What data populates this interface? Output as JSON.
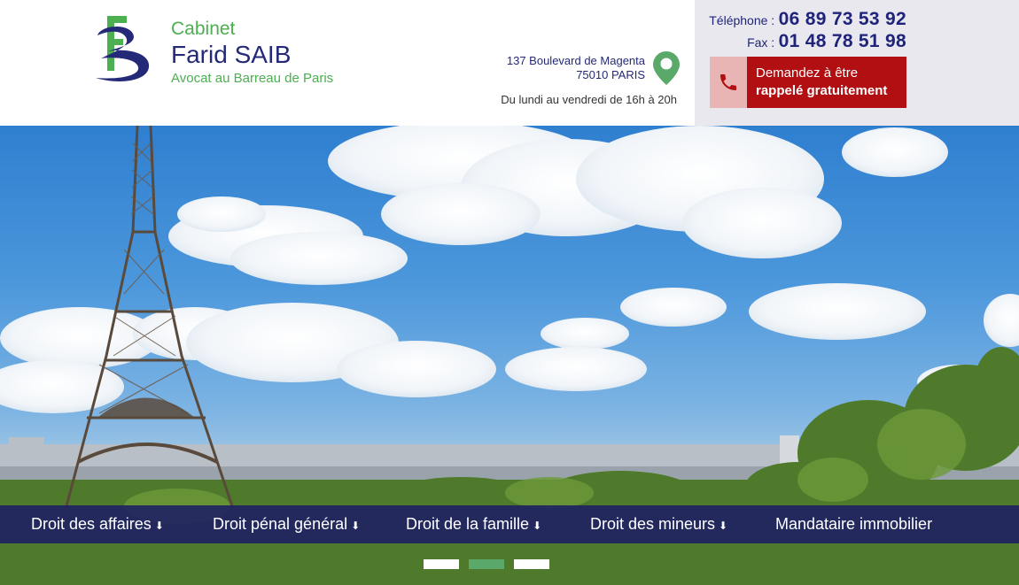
{
  "brand": {
    "line1": "Cabinet",
    "line2": "Farid SAIB",
    "line3": "Avocat au Barreau de Paris",
    "colors": {
      "green": "#4caf50",
      "navy": "#242a78"
    }
  },
  "address": {
    "street": "137 Boulevard de Magenta",
    "city": "75010 PARIS",
    "hours": "Du lundi au vendredi de 16h à 20h",
    "icon": "map-pin-icon"
  },
  "contact": {
    "phone_label": "Téléphone :",
    "phone": "06 89 73 53 92",
    "fax_label": "Fax :",
    "fax": "01 48 78 51 98",
    "callback_line1": "Demandez à être",
    "callback_line2": "rappelé gratuitement",
    "callback_icon": "phone-icon",
    "callback_color": "#b10f12"
  },
  "nav": {
    "items": [
      {
        "label": "Droit des affaires",
        "arrow": "⬇"
      },
      {
        "label": "Droit pénal général",
        "arrow": "⬇"
      },
      {
        "label": "Droit de la famille",
        "arrow": "⬇"
      },
      {
        "label": "Droit des mineurs",
        "arrow": "⬇"
      },
      {
        "label": "Mandataire immobilier"
      }
    ]
  },
  "slider": {
    "count": 3,
    "active_index": 1,
    "active_color": "#5aa86a"
  }
}
